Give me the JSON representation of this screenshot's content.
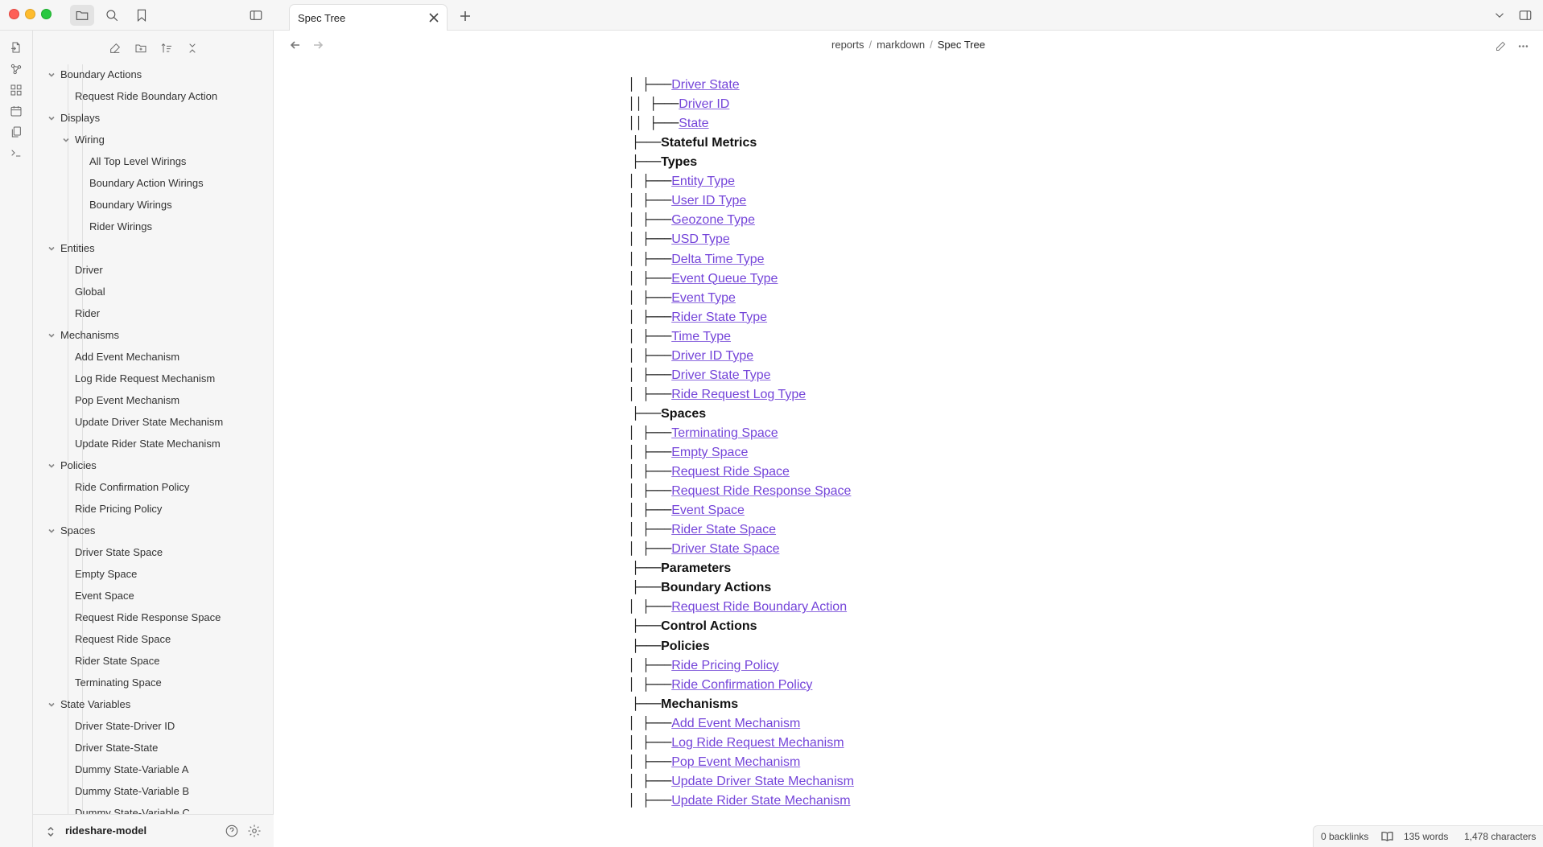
{
  "window": {
    "tab_title": "Spec Tree"
  },
  "breadcrumb": {
    "parts": [
      "reports",
      "markdown"
    ],
    "current": "Spec Tree"
  },
  "sidebar": {
    "items": [
      {
        "label": "Boundary Actions",
        "level": 1,
        "folder": true
      },
      {
        "label": "Request Ride Boundary Action",
        "level": 2,
        "folder": false
      },
      {
        "label": "Displays",
        "level": 1,
        "folder": true
      },
      {
        "label": "Wiring",
        "level": 2,
        "folder": true
      },
      {
        "label": "All Top Level Wirings",
        "level": 3,
        "folder": false
      },
      {
        "label": "Boundary Action Wirings",
        "level": 3,
        "folder": false
      },
      {
        "label": "Boundary Wirings",
        "level": 3,
        "folder": false
      },
      {
        "label": "Rider Wirings",
        "level": 3,
        "folder": false
      },
      {
        "label": "Entities",
        "level": 1,
        "folder": true
      },
      {
        "label": "Driver",
        "level": 2,
        "folder": false
      },
      {
        "label": "Global",
        "level": 2,
        "folder": false
      },
      {
        "label": "Rider",
        "level": 2,
        "folder": false
      },
      {
        "label": "Mechanisms",
        "level": 1,
        "folder": true
      },
      {
        "label": "Add Event Mechanism",
        "level": 2,
        "folder": false
      },
      {
        "label": "Log Ride Request Mechanism",
        "level": 2,
        "folder": false
      },
      {
        "label": "Pop Event Mechanism",
        "level": 2,
        "folder": false
      },
      {
        "label": "Update Driver State Mechanism",
        "level": 2,
        "folder": false
      },
      {
        "label": "Update Rider State Mechanism",
        "level": 2,
        "folder": false
      },
      {
        "label": "Policies",
        "level": 1,
        "folder": true
      },
      {
        "label": "Ride Confirmation Policy",
        "level": 2,
        "folder": false
      },
      {
        "label": "Ride Pricing Policy",
        "level": 2,
        "folder": false
      },
      {
        "label": "Spaces",
        "level": 1,
        "folder": true
      },
      {
        "label": "Driver State Space",
        "level": 2,
        "folder": false
      },
      {
        "label": "Empty Space",
        "level": 2,
        "folder": false
      },
      {
        "label": "Event Space",
        "level": 2,
        "folder": false
      },
      {
        "label": "Request Ride Response Space",
        "level": 2,
        "folder": false
      },
      {
        "label": "Request Ride Space",
        "level": 2,
        "folder": false
      },
      {
        "label": "Rider State Space",
        "level": 2,
        "folder": false
      },
      {
        "label": "Terminating Space",
        "level": 2,
        "folder": false
      },
      {
        "label": "State Variables",
        "level": 1,
        "folder": true
      },
      {
        "label": "Driver State-Driver ID",
        "level": 2,
        "folder": false
      },
      {
        "label": "Driver State-State",
        "level": 2,
        "folder": false
      },
      {
        "label": "Dummy State-Variable A",
        "level": 2,
        "folder": false
      },
      {
        "label": "Dummy State-Variable B",
        "level": 2,
        "folder": false
      },
      {
        "label": "Dummy State-Variable C",
        "level": 2,
        "folder": false
      }
    ]
  },
  "vault": {
    "name": "rideshare-model"
  },
  "document": {
    "lines": [
      {
        "prefix": "│ ├───",
        "text": "Driver State",
        "kind": "link",
        "depth": 2
      },
      {
        "prefix": "││ ├───",
        "text": "Driver ID",
        "kind": "link",
        "depth": 3
      },
      {
        "prefix": "││ ├───",
        "text": "State",
        "kind": "link",
        "depth": 3
      },
      {
        "prefix": "├───",
        "text": "Stateful Metrics",
        "kind": "heading",
        "depth": 1
      },
      {
        "prefix": "├───",
        "text": "Types",
        "kind": "heading",
        "depth": 1
      },
      {
        "prefix": "│ ├───",
        "text": "Entity Type",
        "kind": "link",
        "depth": 2
      },
      {
        "prefix": "│ ├───",
        "text": "User ID Type",
        "kind": "link",
        "depth": 2
      },
      {
        "prefix": "│ ├───",
        "text": "Geozone Type",
        "kind": "link",
        "depth": 2
      },
      {
        "prefix": "│ ├───",
        "text": "USD Type",
        "kind": "link",
        "depth": 2
      },
      {
        "prefix": "│ ├───",
        "text": "Delta Time Type",
        "kind": "link",
        "depth": 2
      },
      {
        "prefix": "│ ├───",
        "text": "Event Queue Type",
        "kind": "link",
        "depth": 2
      },
      {
        "prefix": "│ ├───",
        "text": "Event Type",
        "kind": "link",
        "depth": 2
      },
      {
        "prefix": "│ ├───",
        "text": "Rider State Type",
        "kind": "link",
        "depth": 2
      },
      {
        "prefix": "│ ├───",
        "text": "Time Type",
        "kind": "link",
        "depth": 2
      },
      {
        "prefix": "│ ├───",
        "text": "Driver ID Type",
        "kind": "link",
        "depth": 2
      },
      {
        "prefix": "│ ├───",
        "text": "Driver State Type",
        "kind": "link",
        "depth": 2
      },
      {
        "prefix": "│ ├───",
        "text": "Ride Request Log Type",
        "kind": "link",
        "depth": 2
      },
      {
        "prefix": "├───",
        "text": "Spaces",
        "kind": "heading",
        "depth": 1
      },
      {
        "prefix": "│ ├───",
        "text": "Terminating Space",
        "kind": "link",
        "depth": 2
      },
      {
        "prefix": "│ ├───",
        "text": "Empty Space",
        "kind": "link",
        "depth": 2
      },
      {
        "prefix": "│ ├───",
        "text": "Request Ride Space",
        "kind": "link",
        "depth": 2
      },
      {
        "prefix": "│ ├───",
        "text": "Request Ride Response Space",
        "kind": "link",
        "depth": 2
      },
      {
        "prefix": "│ ├───",
        "text": "Event Space",
        "kind": "link",
        "depth": 2
      },
      {
        "prefix": "│ ├───",
        "text": "Rider State Space",
        "kind": "link",
        "depth": 2
      },
      {
        "prefix": "│ ├───",
        "text": "Driver State Space",
        "kind": "link",
        "depth": 2
      },
      {
        "prefix": "├───",
        "text": "Parameters",
        "kind": "heading",
        "depth": 1
      },
      {
        "prefix": "├───",
        "text": "Boundary Actions",
        "kind": "heading",
        "depth": 1
      },
      {
        "prefix": "│ ├───",
        "text": "Request Ride Boundary Action",
        "kind": "link",
        "depth": 2
      },
      {
        "prefix": "├───",
        "text": "Control Actions",
        "kind": "heading",
        "depth": 1
      },
      {
        "prefix": "├───",
        "text": "Policies",
        "kind": "heading",
        "depth": 1
      },
      {
        "prefix": "│ ├───",
        "text": "Ride Pricing Policy",
        "kind": "link",
        "depth": 2
      },
      {
        "prefix": "│ ├───",
        "text": "Ride Confirmation Policy",
        "kind": "link",
        "depth": 2
      },
      {
        "prefix": "├───",
        "text": "Mechanisms",
        "kind": "heading",
        "depth": 1
      },
      {
        "prefix": "│ ├───",
        "text": "Add Event Mechanism",
        "kind": "link",
        "depth": 2
      },
      {
        "prefix": "│ ├───",
        "text": "Log Ride Request Mechanism",
        "kind": "link",
        "depth": 2
      },
      {
        "prefix": "│ ├───",
        "text": "Pop Event Mechanism",
        "kind": "link",
        "depth": 2
      },
      {
        "prefix": "│ ├───",
        "text": "Update Driver State Mechanism",
        "kind": "link",
        "depth": 2
      },
      {
        "prefix": "│ ├───",
        "text": "Update Rider State Mechanism",
        "kind": "link",
        "depth": 2
      }
    ]
  },
  "status": {
    "backlinks": "0 backlinks",
    "words": "135 words",
    "characters": "1,478 characters"
  },
  "colors": {
    "link": "#7444d9",
    "chrome_bg": "#f6f6f6",
    "close": "#fe5f57",
    "minimize": "#febc2e",
    "zoom": "#28c840"
  },
  "icons": {
    "ribbon": [
      "open-quick-switcher-icon",
      "graph-view-icon",
      "canvas-icon",
      "daily-note-icon",
      "templates-icon",
      "command-palette-icon"
    ],
    "sidebar_toolbar": [
      "new-note-icon",
      "new-folder-icon",
      "sort-icon",
      "collapse-all-icon"
    ]
  }
}
